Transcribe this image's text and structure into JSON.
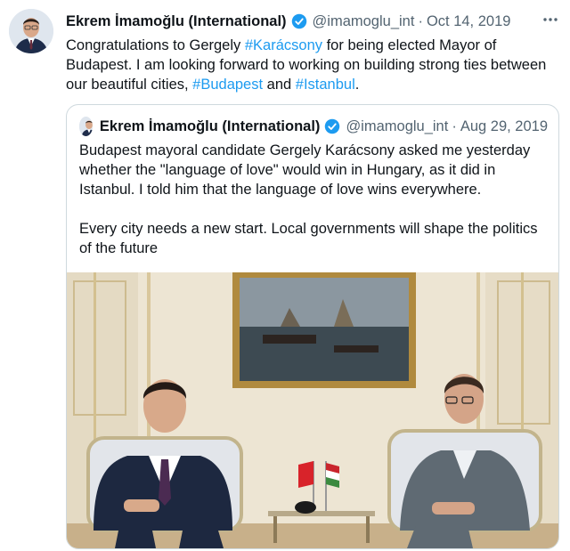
{
  "tweet": {
    "author_name": "Ekrem İmamoğlu (International)",
    "handle": "@imamoglu_int",
    "separator": "·",
    "date": "Oct 14, 2019",
    "more_icon": "more-horizontal-icon",
    "verified_icon": "verified-badge-icon",
    "text_parts": [
      "Congratulations to Gergely ",
      "#Karácsony",
      " for being elected Mayor of Budapest. I am looking forward to working on building strong ties between our beautiful cities, ",
      "#Budapest",
      " and ",
      "#Istanbul",
      "."
    ]
  },
  "quoted": {
    "author_name": "Ekrem İmamoğlu (International)",
    "handle": "@imamoglu_int",
    "separator": "·",
    "date": "Aug 29, 2019",
    "paragraphs": [
      "Budapest mayoral candidate Gergely Karácsony asked me yesterday whether the \"language of love\" would win in Hungary, as it did in Istanbul. I told him that the language of love wins everywhere.",
      "Every city needs a new start. Local governments will shape the politics of the future"
    ]
  },
  "colors": {
    "link": "#1d9bf0",
    "text": "#0f1419",
    "muted": "#536471",
    "border": "#cfd9de"
  }
}
